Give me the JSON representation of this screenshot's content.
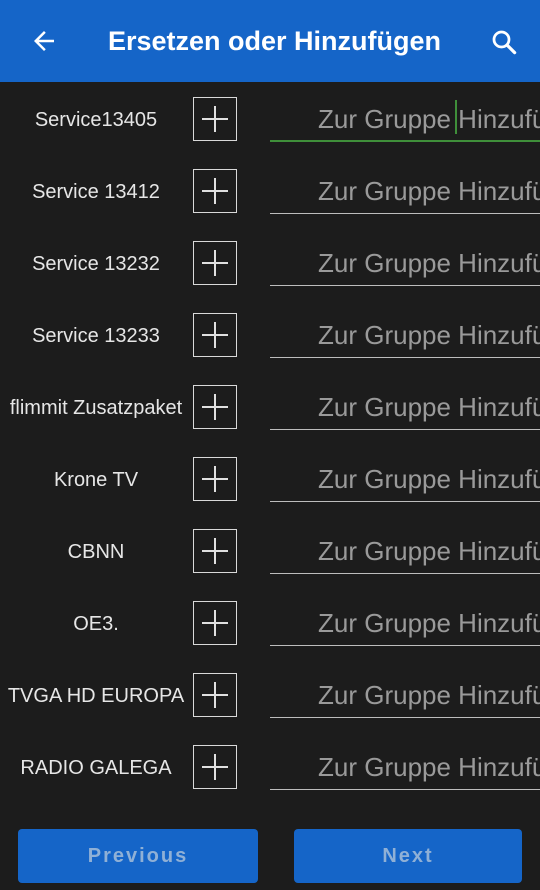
{
  "header": {
    "title": "Ersetzen oder Hinzufügen",
    "back_icon": "arrow-left-icon",
    "search_icon": "search-icon"
  },
  "list": {
    "placeholder": "Zur Gruppe Hinzufügen",
    "items": [
      {
        "name": "Service13405"
      },
      {
        "name": "Service 13412"
      },
      {
        "name": "Service 13232"
      },
      {
        "name": "Service 13233"
      },
      {
        "name": "flimmit Zusatzpaket"
      },
      {
        "name": "Krone TV"
      },
      {
        "name": "CBNN"
      },
      {
        "name": "OE3."
      },
      {
        "name": "TVGA HD EUROPA"
      },
      {
        "name": "RADIO GALEGA"
      }
    ]
  },
  "footer": {
    "previous_label": "Previous",
    "next_label": "Next"
  },
  "colors": {
    "appbar": "#1565c8",
    "background": "#1c1c1c",
    "focus_accent": "#3f8f3a"
  }
}
